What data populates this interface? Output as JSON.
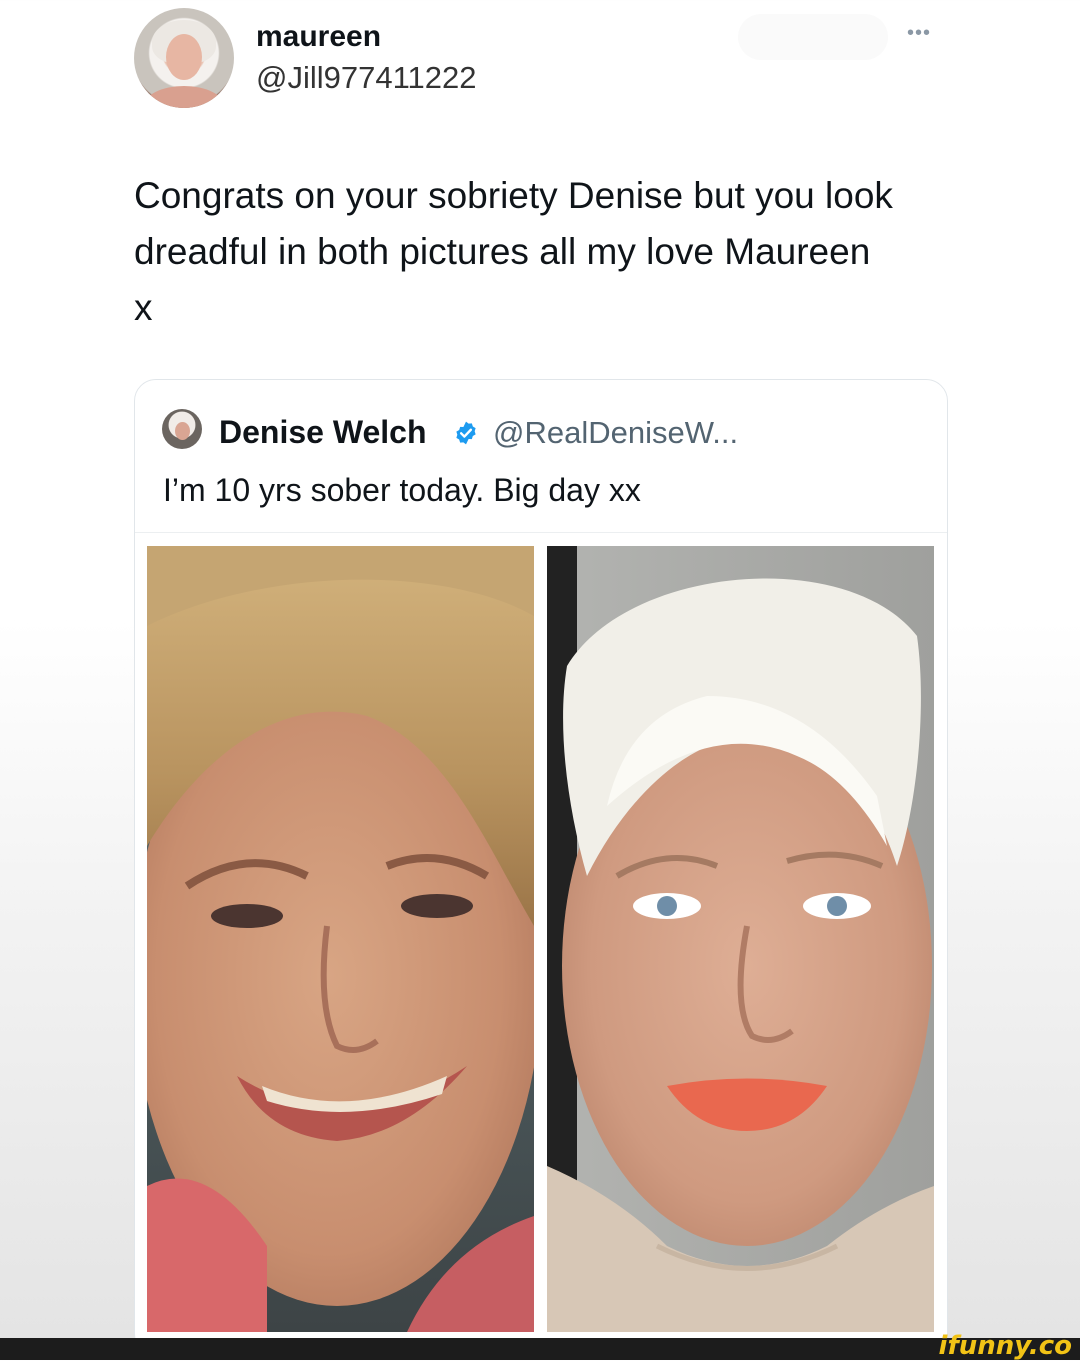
{
  "author": {
    "display_name": "maureen",
    "handle": "@Jill977411222",
    "avatar_icon": "profile-photo"
  },
  "more_icon": "more-options-icon",
  "tweet": {
    "text": "Congrats on your sobriety Denise but you look\ndreadful in both pictures all my love Maureen\nx"
  },
  "quoted_tweet": {
    "display_name": "Denise Welch",
    "verified": true,
    "verified_icon": "verified-badge-icon",
    "handle": "@RealDeniseW...",
    "text": "I’m 10 yrs sober today. Big day xx",
    "images": [
      {
        "name": "before-photo",
        "description_icon": "portrait-photo"
      },
      {
        "name": "after-photo",
        "description_icon": "portrait-photo"
      }
    ]
  },
  "watermark": {
    "text": "ifunny.co",
    "color": "#f2c316"
  },
  "colors": {
    "text_primary": "#0f1419",
    "text_secondary": "#536471",
    "verified_blue": "#1d9bf0",
    "card_border": "#e1e6ea"
  }
}
